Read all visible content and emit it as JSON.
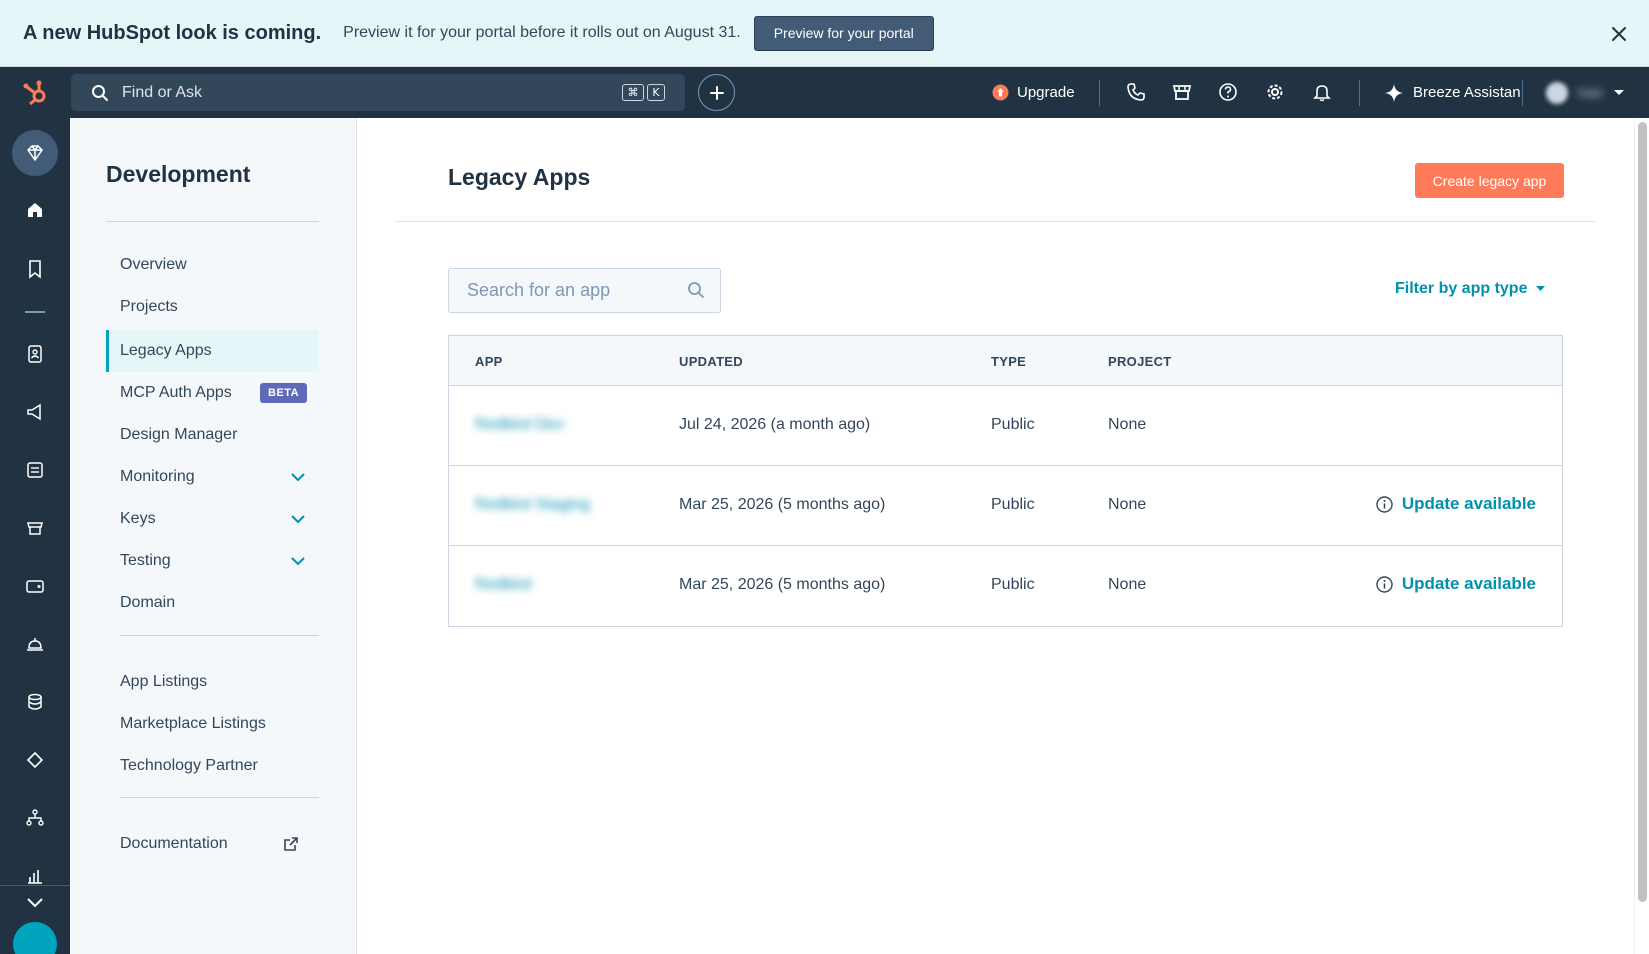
{
  "banner": {
    "title": "A new HubSpot look is coming.",
    "text": "Preview it for your portal before it rolls out on August 31.",
    "button": "Preview for your portal"
  },
  "topnav": {
    "search_placeholder": "Find or Ask",
    "shortcut_keys": [
      "⌘",
      "K"
    ],
    "upgrade": "Upgrade",
    "assistant": "Breeze Assistan",
    "user_name": "Ivan"
  },
  "sidebar": {
    "title": "Development",
    "items": [
      {
        "label": "Overview"
      },
      {
        "label": "Projects"
      },
      {
        "label": "Legacy Apps"
      },
      {
        "label": "MCP Auth Apps",
        "badge": "BETA"
      },
      {
        "label": "Design Manager"
      },
      {
        "label": "Monitoring"
      },
      {
        "label": "Keys"
      },
      {
        "label": "Testing"
      },
      {
        "label": "Domain"
      }
    ],
    "secondary": [
      {
        "label": "App Listings"
      },
      {
        "label": "Marketplace Listings"
      },
      {
        "label": "Technology Partner"
      }
    ],
    "documentation": "Documentation"
  },
  "main": {
    "title": "Legacy Apps",
    "create_button": "Create legacy app",
    "search_placeholder": "Search for an app",
    "filter_label": "Filter by app type",
    "columns": [
      "APP",
      "UPDATED",
      "TYPE",
      "PROJECT"
    ],
    "rows": [
      {
        "app": "Redbird Dev",
        "updated": "Jul 24, 2026 (a month ago)",
        "type": "Public",
        "project": "None",
        "status": ""
      },
      {
        "app": "Redbird Staging",
        "updated": "Mar 25, 2026 (5 months ago)",
        "type": "Public",
        "project": "None",
        "status": "Update available"
      },
      {
        "app": "Redbird",
        "updated": "Mar 25, 2026 (5 months ago)",
        "type": "Public",
        "project": "None",
        "status": "Update available"
      }
    ]
  },
  "colors": {
    "nav_bg": "#213343",
    "accent_orange": "#ff7a59",
    "link_teal": "#0091ae",
    "banner_bg": "#e5f5f8",
    "beta_badge": "#5e6ab8"
  }
}
